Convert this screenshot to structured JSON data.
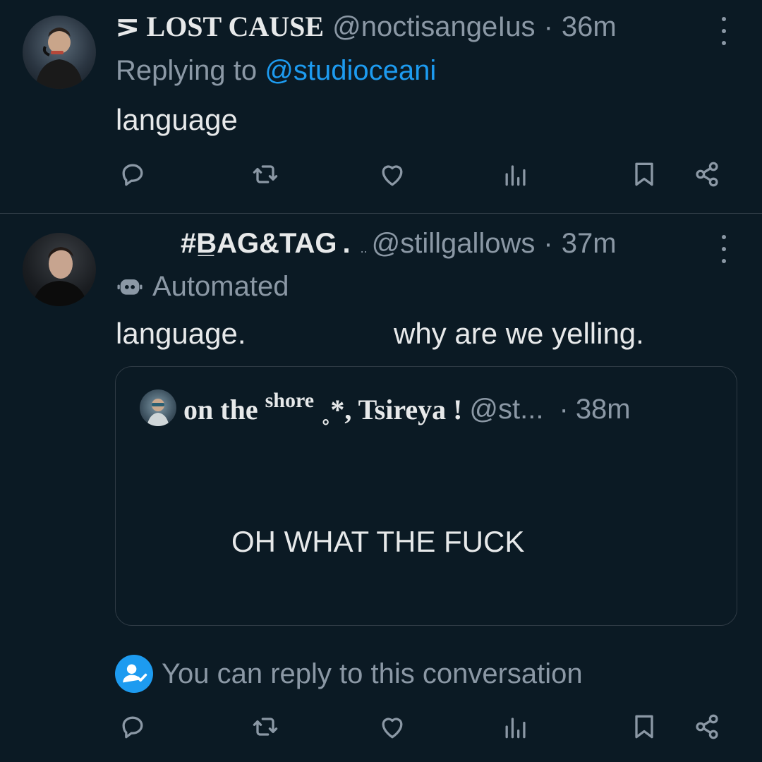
{
  "tweet1": {
    "display_name": "⋝ LOST CAUSE",
    "handle": "@noctisangeIus",
    "sep": "·",
    "time": "36m",
    "replying_prefix": "Replying to",
    "replying_handle": "@studioceani",
    "text": "language"
  },
  "tweet2": {
    "display_name": "#B̲AG&TAG",
    "display_name_suffix": ".",
    "dots": "..",
    "handle": "@stillgallows",
    "sep": "·",
    "time": "37m",
    "automated_label": "Automated",
    "text_a": "language.",
    "text_b": "why are we yelling.",
    "quote": {
      "name_part1": "on the",
      "name_super": "shore",
      "name_part2": "˳*, Tsireya !",
      "handle": "@st...",
      "sep": "·",
      "time": "38m",
      "text": "OH WHAT THE FUCK"
    },
    "reply_notice": "You can reply to this conversation"
  },
  "colors": {
    "background": "#0b1a24",
    "text": "#e7e9ea",
    "muted": "#8b98a5",
    "link": "#1d9bf0",
    "divider": "#2f3b45"
  },
  "icons": [
    "reply-icon",
    "retweet-icon",
    "like-icon",
    "views-icon",
    "bookmark-icon",
    "share-icon",
    "more-icon",
    "robot-icon",
    "person-check-icon"
  ]
}
